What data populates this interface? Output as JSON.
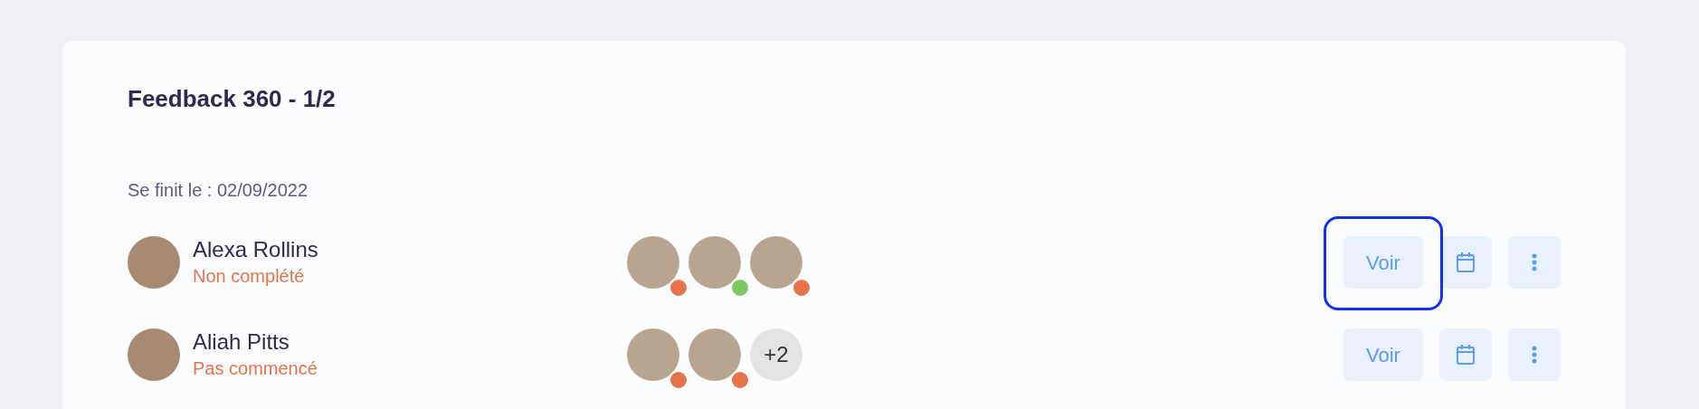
{
  "card": {
    "title": "Feedback 360 - 1/2",
    "end_date": "Se finit le : 02/09/2022",
    "rows": [
      {
        "name": "Alexa Rollins",
        "status": "Non complété",
        "reviewers": [
          {
            "kind": "photo",
            "color": "#e8734a"
          },
          {
            "kind": "photo",
            "color": "#7ac95e"
          },
          {
            "kind": "photo",
            "color": "#e8734a"
          }
        ],
        "view_button": {
          "label": "Voir",
          "focused": true
        }
      },
      {
        "name": "Aliah Pitts",
        "status": "Pas commencé",
        "reviewers": [
          {
            "kind": "photo",
            "color": "#e8734a"
          },
          {
            "kind": "photo",
            "color": "#e8734a"
          },
          {
            "kind": "more",
            "label": "+2"
          }
        ],
        "view_button": {
          "label": "Voir",
          "focused": false
        }
      }
    ]
  }
}
